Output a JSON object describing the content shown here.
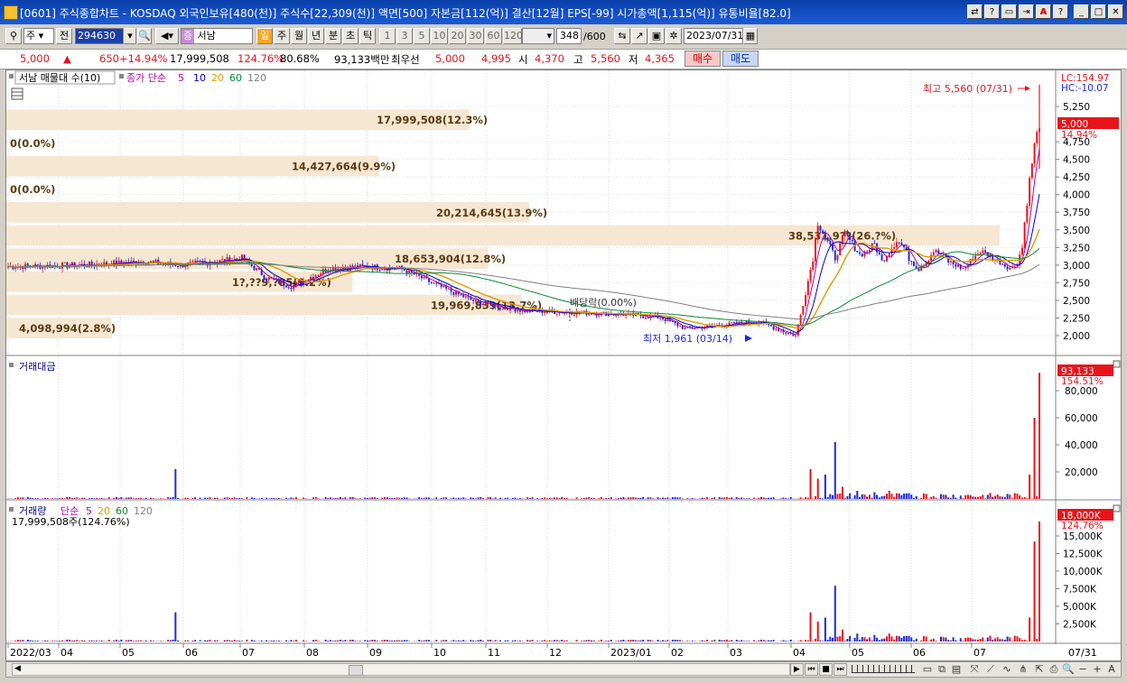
{
  "window": {
    "title": "[0601] 주식종합차트 - KOSDAQ 외국인보유[480(천)] 주식수[22,309(천)] 액면[500] 자본금[112(억)] 결산[12월] EPS[-99] 시가총액[1,115(억)] 유통비율[82.0]",
    "title_buttons": [
      "⇄",
      "?",
      "▭",
      "⇥",
      "A",
      "?",
      "_",
      "□",
      "✕"
    ]
  },
  "toolbar": {
    "market": "주",
    "prev_label": "전",
    "code": "294630",
    "stock_badge": "증",
    "stock_name": "서남",
    "periods": [
      "일",
      "주",
      "월",
      "년",
      "분",
      "초",
      "틱"
    ],
    "active_period": "일",
    "intervals": [
      "1",
      "3",
      "5",
      "10",
      "20",
      "30",
      "60",
      "120"
    ],
    "interval_dropdown_value": "",
    "count": "348",
    "count_max": "/600",
    "date": "2023/07/31"
  },
  "quote": {
    "price": "5,000",
    "change": "650",
    "change_pct": "+14.94%",
    "volume": "17,999,508",
    "volume_ratio": "124.76%",
    "turnover": "80.68%",
    "amount": "93,133백만",
    "best_label": "최우선",
    "best_ask": "5,000",
    "best_bid": "4,995",
    "open_label": "시",
    "open": "4,370",
    "high_label": "고",
    "high": "5,560",
    "low_label": "저",
    "low": "4,365",
    "buy_label": "매수",
    "sell_label": "매도"
  },
  "price_panel": {
    "legend_name": "서남 매물대 수(10)",
    "legend_ma_prefix": "종가 단순",
    "ma_periods": [
      "5",
      "10",
      "20",
      "60",
      "120"
    ],
    "lc": "LC:154.97",
    "hc": "HC:-10.07",
    "current_price_tag": "5,000",
    "current_pct_tag": "14.94%",
    "high_annotation": "최고 5,560 (07/31)",
    "low_annotation": "최저 1,961 (03/14)",
    "dividend_annotation": "배당락(0.00%)",
    "y_ticks": [
      "5,250",
      "4,750",
      "4,500",
      "4,250",
      "4,000",
      "3,750",
      "3,500",
      "3,250",
      "3,000",
      "2,750",
      "2,500",
      "2,250",
      "2,000"
    ],
    "volume_profile": [
      {
        "label": "",
        "value": 0
      },
      {
        "label": "17,999,508(12.3%)",
        "value": 12.3
      },
      {
        "label": "0(0.0%)",
        "value": 0
      },
      {
        "label": "14,427,664(9.9%)",
        "value": 9.9
      },
      {
        "label": "0(0.0%)",
        "value": 0
      },
      {
        "label": "20,214,645(13.9%)",
        "value": 13.9
      },
      {
        "label": "38,531,9??(26.?%)",
        "value": 26.4
      },
      {
        "label": "18,653,904(12.8%)",
        "value": 12.8
      },
      {
        "label": "1?,??9,?85(9.2%)",
        "value": 9.2
      },
      {
        "label": "19,969,839(13.7%)",
        "value": 13.7
      },
      {
        "label": "4,098,994(2.8%)",
        "value": 2.8
      }
    ]
  },
  "amount_panel": {
    "legend": "거래대금",
    "y_ticks": [
      "80,000",
      "60,000",
      "40,000",
      "20,000"
    ],
    "last_tag": "93,133",
    "last_pct": "154.51%"
  },
  "volume_panel": {
    "legend": "거래량",
    "legend_ma_prefix": "단순",
    "ma_periods": [
      "5",
      "20",
      "60",
      "120"
    ],
    "summary": "17,999,508주(124.76%)",
    "y_ticks": [
      "15,000K",
      "12,500K",
      "10,000K",
      "7,500K",
      "5,000K",
      "2,500K"
    ],
    "last_tag": "18,000K",
    "last_pct": "124.76%"
  },
  "x_axis": {
    "labels": [
      "2022/03",
      "04",
      "05",
      "06",
      "07",
      "08",
      "09",
      "10",
      "11",
      "12",
      "2023/01",
      "02",
      "03",
      "04",
      "05",
      "06",
      "07"
    ],
    "right_label": "07/31"
  },
  "colors": {
    "up": "#e8141b",
    "down": "#1c2bd8",
    "ma5": "#b000b0",
    "ma10": "#0000cc",
    "ma20": "#e09a00",
    "ma60": "#0a8a30",
    "ma120": "#808080",
    "profile": "#f6e7d2",
    "title_bg": "#0a3fa8"
  }
}
